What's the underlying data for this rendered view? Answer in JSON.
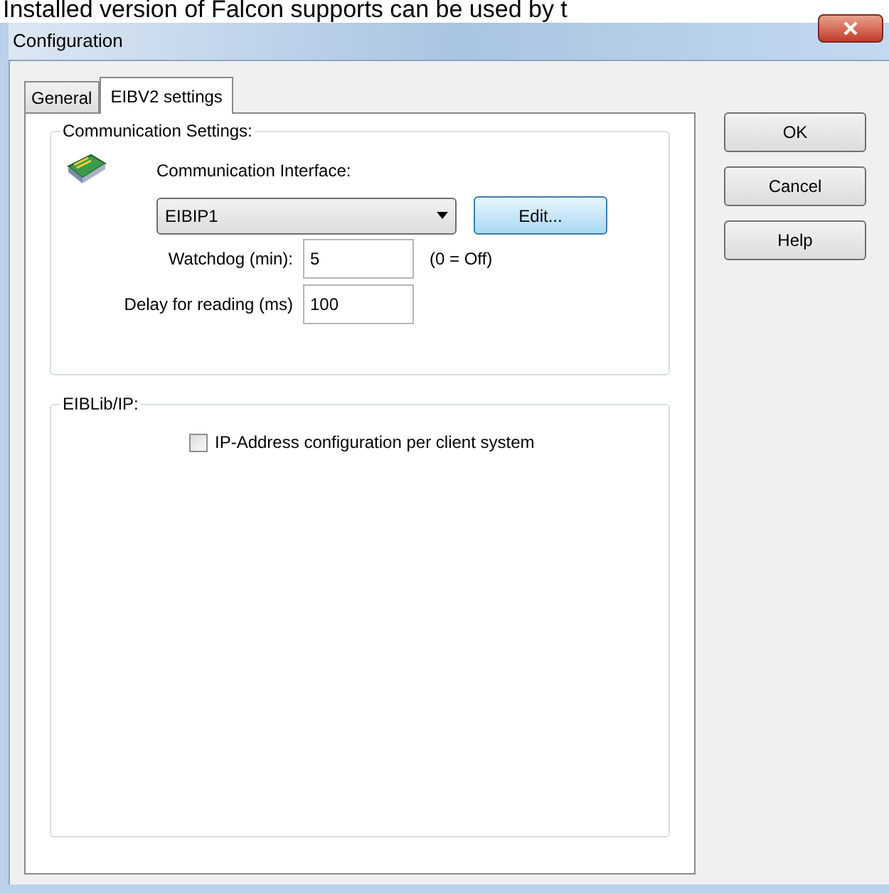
{
  "caption_text": "Installed version of Falcon supports can be used by t",
  "window": {
    "title": "Configuration"
  },
  "tabs": [
    {
      "label": "General",
      "selected": false
    },
    {
      "label": "EIBV2 settings",
      "selected": true
    }
  ],
  "communication_settings": {
    "title": "Communication Settings:",
    "interface_label": "Communication Interface:",
    "interface_value": "EIBIP1",
    "edit_button": "Edit...",
    "watchdog_label": "Watchdog (min):",
    "watchdog_value": "5",
    "watchdog_hint": "(0 = Off)",
    "delay_label": "Delay for reading (ms)",
    "delay_value": "100"
  },
  "eiblib_ip": {
    "title": "EIBLib/IP:",
    "checkbox": {
      "label": "IP-Address configuration per client system",
      "checked": false
    }
  },
  "buttons": [
    "OK",
    "Cancel",
    "Help"
  ]
}
